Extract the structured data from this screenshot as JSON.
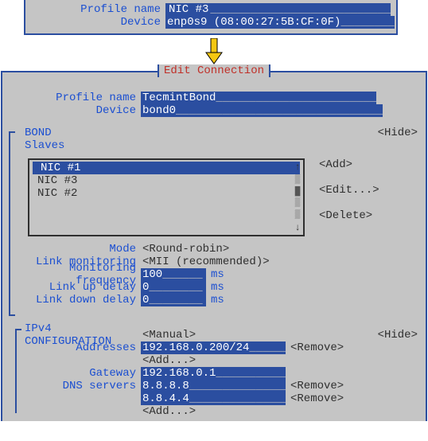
{
  "top": {
    "profile_label": "Profile name",
    "profile_value": "NIC #3",
    "device_label": "Device",
    "device_value": "enp0s9 (08:00:27:5B:CF:0F)"
  },
  "title": "Edit Connection",
  "main": {
    "profile_label": "Profile name",
    "profile_value": "TecmintBond",
    "device_label": "Device",
    "device_value": "bond0"
  },
  "bond": {
    "heading": "BOND",
    "slaves_label": "Slaves",
    "hide": "<Hide>",
    "items": [
      "NIC #1",
      "NIC #3",
      "NIC #2"
    ],
    "buttons": {
      "add": "<Add>",
      "edit": "<Edit...>",
      "delete": "<Delete>"
    },
    "scroll": {
      "up": "↑",
      "down": "↓",
      "track": "▒",
      "thumb": "█"
    },
    "mode_label": "Mode",
    "mode_value": "<Round-robin>",
    "linkmon_label": "Link monitoring",
    "linkmon_value": "<MII (recommended)>",
    "freq_label": "Monitoring frequency",
    "freq_value": "100",
    "up_label": "Link up delay",
    "up_value": "0",
    "down_label": "Link down delay",
    "down_value": "0",
    "unit": "ms"
  },
  "ipv4": {
    "heading": "IPv4 CONFIGURATION",
    "mode": "<Manual>",
    "hide": "<Hide>",
    "addresses_label": "Addresses",
    "addr_value": "192.168.0.200/24",
    "gateway_label": "Gateway",
    "gateway_value": "192.168.0.1",
    "dns_label": "DNS servers",
    "dns1": "8.8.8.8",
    "dns2": "8.8.4.4",
    "remove": "<Remove>",
    "add": "<Add...>"
  }
}
